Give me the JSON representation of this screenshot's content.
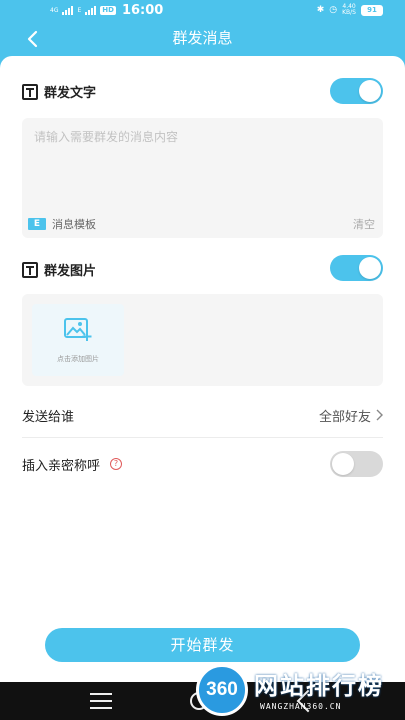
{
  "status_bar": {
    "network_label": "4G",
    "network_label2": "E",
    "hd_badge": "HD",
    "time": "16:00",
    "speed_value": "4.40",
    "speed_unit": "KB/S",
    "battery": "91"
  },
  "nav": {
    "title": "群发消息"
  },
  "text_section": {
    "label": "群发文字",
    "toggle_on": true,
    "placeholder": "请输入需要群发的消息内容",
    "template_icon": "E",
    "template_label": "消息模板",
    "clear_label": "清空"
  },
  "image_section": {
    "label": "群发图片",
    "toggle_on": true,
    "add_image_label": "点击添加图片"
  },
  "send_to": {
    "label": "发送给谁",
    "value": "全部好友"
  },
  "nickname": {
    "label": "插入亲密称呼",
    "help_icon": "?",
    "toggle_on": false
  },
  "start_button": {
    "label": "开始群发"
  },
  "watermark": {
    "logo_text": "360",
    "title": "网站排行榜",
    "subtitle": "WANGZHAN360.CN"
  },
  "colors": {
    "accent": "#4cc3ec",
    "toggle_off": "#d9d9d9",
    "help_red": "#e05b5b"
  }
}
